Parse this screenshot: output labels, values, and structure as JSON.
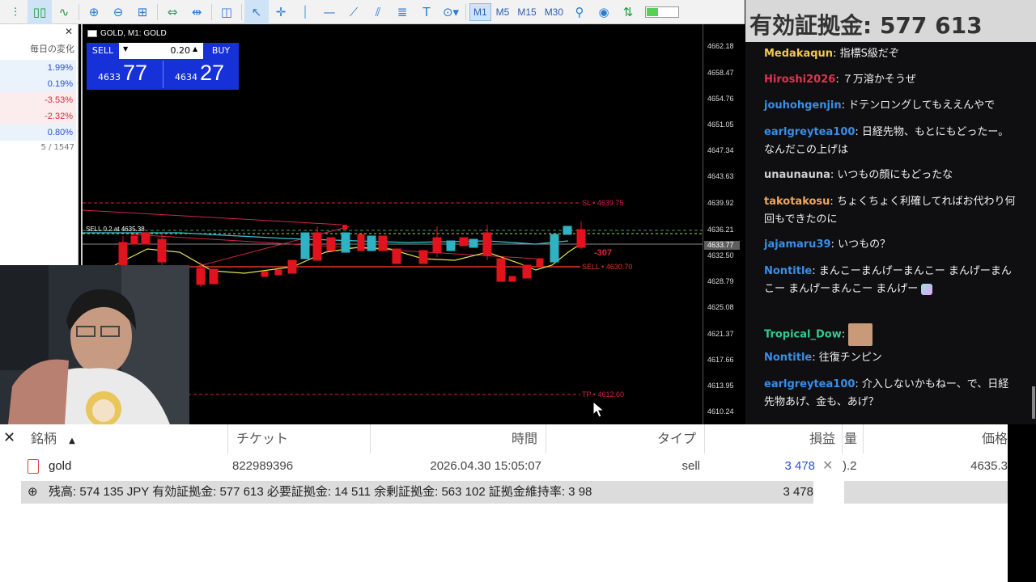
{
  "toolbar": {
    "timeframes": [
      "M1",
      "M5",
      "M15",
      "M30"
    ],
    "active_timeframe": "M1"
  },
  "market_watch": {
    "header": "毎日の変化",
    "changes": [
      "1.99%",
      "0.19%",
      "-3.53%",
      "-2.32%",
      "0.80%"
    ],
    "footer": "5 / 1547"
  },
  "chart": {
    "title": "GOLD, M1: GOLD",
    "one_click": {
      "sell_label": "SELL",
      "buy_label": "BUY",
      "volume": "0.20",
      "sell_price_small": "4633",
      "sell_price_big": "77",
      "buy_price_small": "4634",
      "buy_price_big": "27"
    },
    "price_axis": [
      "4662.18",
      "4658.47",
      "4654.76",
      "4651.05",
      "4647.34",
      "4643.63",
      "4639.92",
      "4636.21",
      "4632.50",
      "4628.79",
      "4625.08",
      "4621.37",
      "4617.66",
      "4613.95",
      "4610.24"
    ],
    "current_price": "4633.77",
    "levels": {
      "sl": "SL • 4639.75",
      "sell": "SELL • 4630.70",
      "tp": "TP • 4612.60",
      "order_label": "SELL 0.2 at 4635.38",
      "pnl": "-307"
    }
  },
  "chat": {
    "header": "有効証拠金: 577 613",
    "messages": [
      {
        "user": "Medakaqun",
        "color": "#f2c94c",
        "text": "指標S級だぞ"
      },
      {
        "user": "Hiroshi2026",
        "color": "#e0334f",
        "text": "７万溶かそうぜ"
      },
      {
        "user": "jouhohgenjin",
        "color": "#3a8ee6",
        "text": "ドテンロングしてもええんやで"
      },
      {
        "user": "earlgreytea100",
        "color": "#3a8ee6",
        "text": "日経先物、もとにもどったー。なんだこの上げは"
      },
      {
        "user": "unaunauna",
        "color": "#d0d0d0",
        "text": "いつもの顔にもどったな"
      },
      {
        "user": "takotakosu",
        "color": "#f2a65a",
        "text": "ちょくちょく利確してればお代わり何回もできたのに"
      },
      {
        "user": "jajamaru39",
        "color": "#3a8ee6",
        "text": "いつもの？"
      },
      {
        "user": "Nontitle",
        "color": "#3a8ee6",
        "text": "まんこーまんげーまんこー まんげーまんこー まんげーまんこー まんげー"
      },
      {
        "user": "Tropical_Dow",
        "color": "#2ecc8f",
        "text": ""
      },
      {
        "user": "Nontitle",
        "color": "#3a8ee6",
        "text": "往復チンピン"
      },
      {
        "user": "earlgreytea100",
        "color": "#3a8ee6",
        "text": "介入しないかもねー、で、日経先物あげ、金も、あげ？"
      }
    ]
  },
  "positions": {
    "columns": [
      "銘柄",
      "チケット",
      "時間",
      "タイプ",
      "損益",
      "量",
      "価格"
    ],
    "row": {
      "symbol": "gold",
      "ticket": "822989396",
      "time": "2026.04.30 15:05:07",
      "type": "sell",
      "profit": "3 478",
      "volume": ").2",
      "price": "4635.3"
    },
    "summary": "残高: 574 135 JPY  有効証拠金: 577 613  必要証拠金: 14 511  余剰証拠金: 563 102  証拠金維持率: 3 98",
    "summary_profit": "3 478"
  }
}
